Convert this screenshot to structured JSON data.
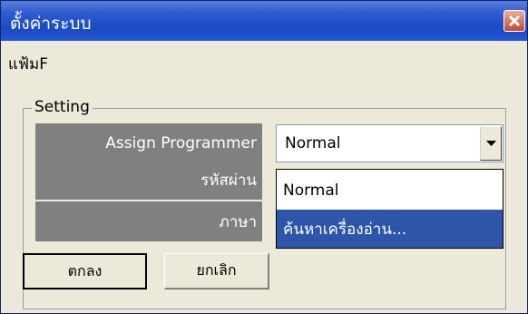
{
  "window": {
    "title": "ตั้งค่าระบบ",
    "menu": "แฟ้มF"
  },
  "group": {
    "label": "Setting"
  },
  "fields": [
    {
      "label": "Assign Programmer"
    },
    {
      "label": "รหัสผ่าน"
    },
    {
      "label": "ภาษา"
    }
  ],
  "combo": {
    "selected": "Normal",
    "options": [
      "Normal",
      "ค้นหาเครื่องอ่าน..."
    ]
  },
  "buttons": {
    "ok": "ตกลง",
    "cancel": "ยกเลิก"
  },
  "colors": {
    "titlebar": "#1a4bc4",
    "selection": "#2d56a8",
    "label_bg": "#808080",
    "window_bg": "#ece9d8"
  },
  "icons": {
    "close": "close-icon",
    "dropdown": "dropdown-arrow-icon"
  }
}
